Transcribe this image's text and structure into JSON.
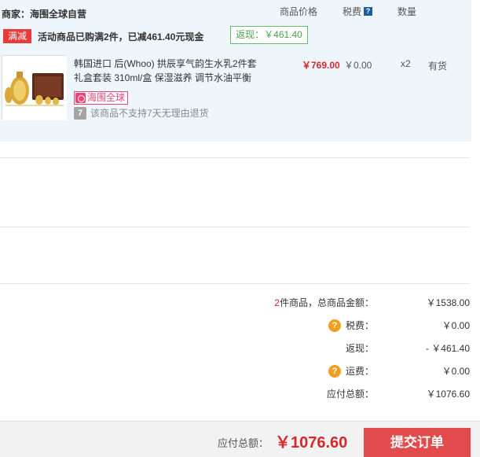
{
  "header": {
    "merchant_label": "商家：",
    "merchant_name": "海围全球自营",
    "col_price": "商品价格",
    "col_tax": "税费",
    "col_tax_help": "?",
    "col_qty": "数量"
  },
  "promo": {
    "tag": "满减",
    "text": "活动商品已购满2件，已减461.40元现金",
    "rebate": "返现：￥461.40"
  },
  "product": {
    "title_line1": "韩国进口 后(Whoo) 拱辰享气韵生水乳2件套",
    "title_line2": "礼盒套装 310ml/盒 保湿滋养 调节水油平衡",
    "price": "￥769.00",
    "tax": "￥0.00",
    "qty": "x2",
    "stock": "有货",
    "badge": "海围全球",
    "return_icon": "7",
    "return_note": "该商品不支持7天无理由退货"
  },
  "summary": {
    "count": "2",
    "count_label": "件商品，总商品金额：",
    "goods_total": "￥1538.00",
    "tax_label": "税费：",
    "tax_value": "￥0.00",
    "rebate_label": "返现：",
    "rebate_value": "- ￥461.40",
    "shipping_label": "运费：",
    "shipping_value": "￥0.00",
    "due_label": "应付总额：",
    "due_value": "￥1076.60",
    "help_glyph": "?"
  },
  "footer": {
    "total_label": "应付总额：",
    "total_value": "￥1076.60",
    "submit_label": "提交订单"
  },
  "colors": {
    "accent_red": "#d4282d",
    "button_red": "#e14b4b",
    "rebate_green": "#4a9f4a",
    "badge_pink": "#e8457a",
    "cart_bg": "#eef6fb"
  },
  "icons": {
    "tax_help": "question-square-icon",
    "global_badge": "global-store-icon",
    "no_return": "no-7day-return-icon",
    "summary_help": "question-circle-icon"
  }
}
